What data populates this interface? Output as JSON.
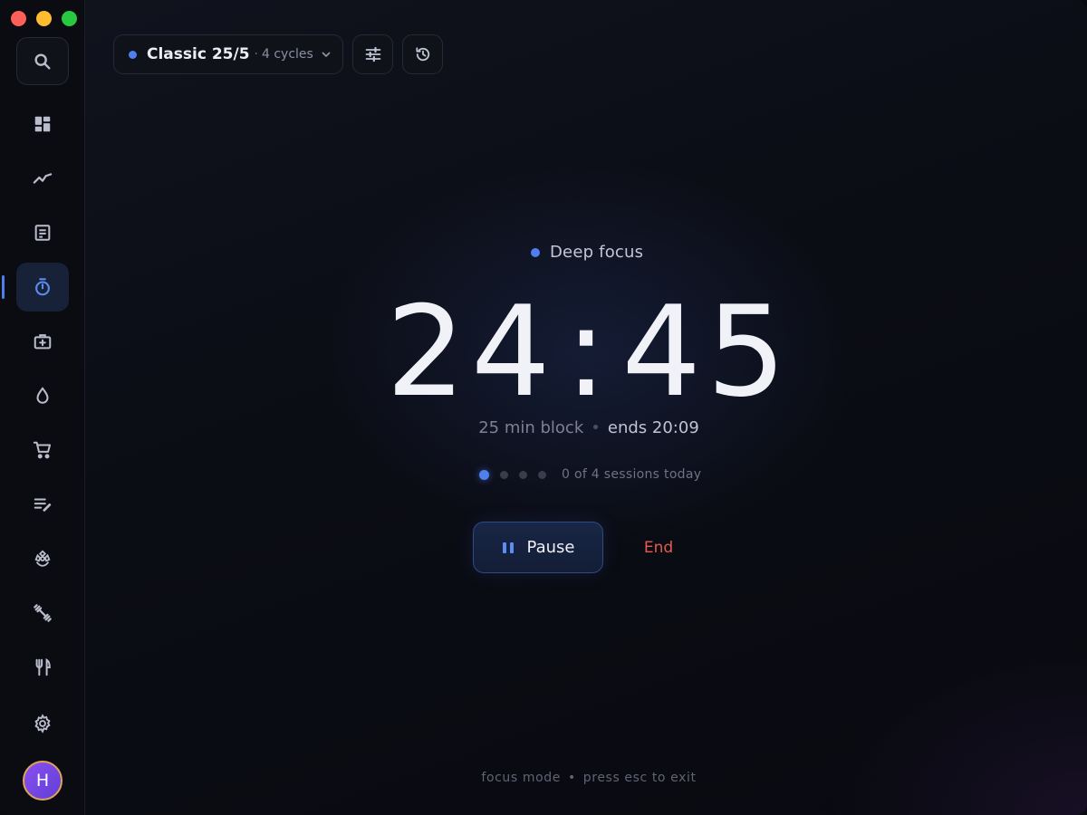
{
  "window": {
    "controls": [
      "close",
      "minimize",
      "maximize"
    ]
  },
  "sidebar": {
    "items": [
      {
        "icon": "search-icon"
      },
      {
        "icon": "dashboard-icon"
      },
      {
        "icon": "trend-icon"
      },
      {
        "icon": "notes-icon"
      },
      {
        "icon": "timer-icon",
        "active": true
      },
      {
        "icon": "medical-kit-icon"
      },
      {
        "icon": "water-drop-icon"
      },
      {
        "icon": "cart-icon"
      },
      {
        "icon": "list-edit-icon"
      },
      {
        "icon": "meditation-icon"
      },
      {
        "icon": "fitness-icon"
      },
      {
        "icon": "cutlery-icon"
      },
      {
        "icon": "settings-icon"
      }
    ],
    "avatar_initial": "H"
  },
  "toolbar": {
    "preset_name": "Classic 25/5",
    "preset_separator": "·",
    "preset_cycles": "4 cycles"
  },
  "focus": {
    "mode_label": "Deep focus",
    "minutes": "24",
    "colon": ":",
    "seconds": "45",
    "block_label": "25 min block",
    "bullet": "•",
    "ends_label": "ends 20:09",
    "sessions_text": "0 of 4 sessions today",
    "sessions_done_fraction": 0,
    "pause_label": "Pause",
    "end_label": "End"
  },
  "footer": {
    "mode": "focus mode",
    "bullet": "•",
    "hint": "press esc to exit"
  },
  "colors": {
    "accent": "#4f7ff0",
    "end": "#e55a4e"
  }
}
